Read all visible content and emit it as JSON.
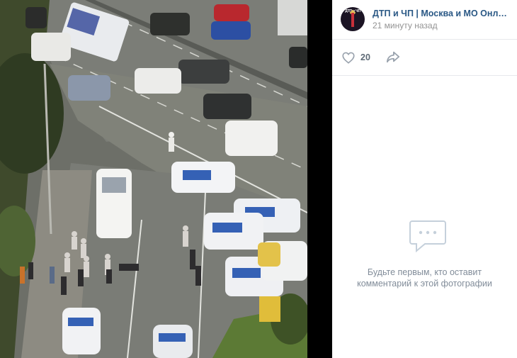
{
  "post": {
    "group_name": "ДТП и ЧП | Москва и МО Онлайн | Новости",
    "time": "21 минуту назад",
    "avatar_text": "ДТП и ЧП"
  },
  "actions": {
    "like_count": "20",
    "like_icon": "heart-icon",
    "share_icon": "share-arrow-icon"
  },
  "comments": {
    "empty_line1": "Будьте первым, кто оставит",
    "empty_line2": "комментарий к этой фотографии",
    "empty_icon": "comment-bubble-icon"
  },
  "colors": {
    "link": "#2a5885",
    "muted": "#939393",
    "icon": "#99a2ad"
  }
}
